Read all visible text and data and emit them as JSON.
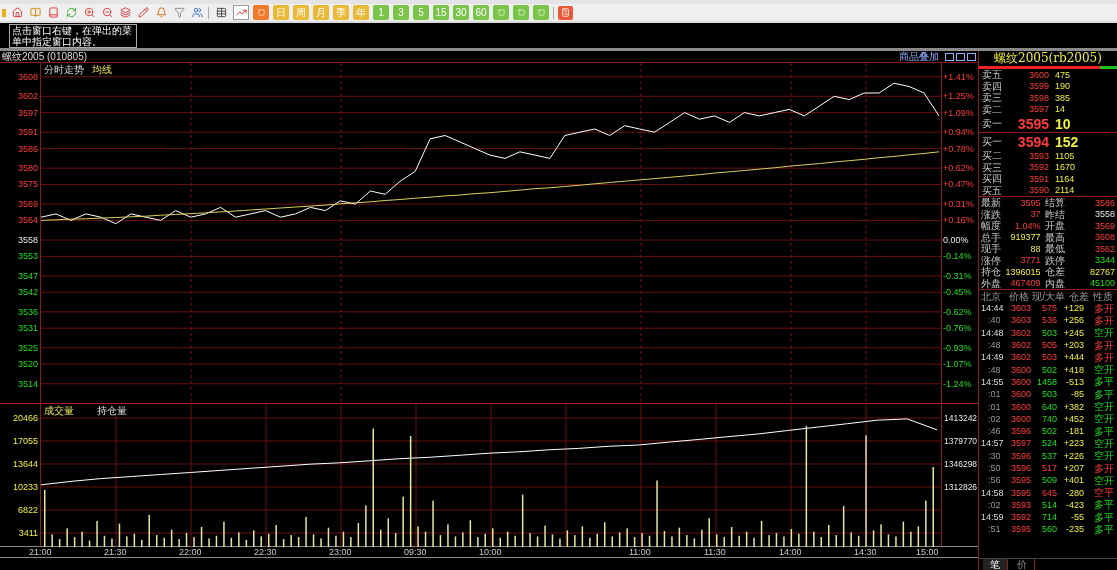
{
  "toolbar": {
    "tools": [
      {
        "kind": "table",
        "selected": false
      },
      {
        "kind": "trend",
        "selected": true
      }
    ],
    "periods": [
      {
        "kind": "tick",
        "color": "#f07a2a"
      },
      {
        "kind": "label",
        "label": "日",
        "color": "#e9b93a"
      },
      {
        "kind": "label",
        "label": "周",
        "color": "#e9b93a"
      },
      {
        "kind": "label",
        "label": "月",
        "color": "#e9b93a"
      },
      {
        "kind": "label",
        "label": "季",
        "color": "#e9b93a"
      },
      {
        "kind": "label",
        "label": "年",
        "color": "#e9b93a"
      },
      {
        "kind": "label",
        "label": "1",
        "color": "#7bc44a"
      },
      {
        "kind": "label",
        "label": "3",
        "color": "#7bc44a"
      },
      {
        "kind": "label",
        "label": "5",
        "color": "#7bc44a"
      },
      {
        "kind": "label",
        "label": "15",
        "color": "#7bc44a"
      },
      {
        "kind": "label",
        "label": "30",
        "color": "#7bc44a"
      },
      {
        "kind": "label",
        "label": "60",
        "color": "#7bc44a"
      },
      {
        "kind": "tick",
        "color": "#7bc44a"
      },
      {
        "kind": "tick",
        "color": "#7bc44a"
      },
      {
        "kind": "tick",
        "color": "#7bc44a"
      }
    ]
  },
  "tooltip": "点击窗口右键，在弹出的菜单中指定窗口内容。",
  "chart_header": {
    "title": "螺纹2005 (010805)",
    "overlay_button": "商品叠加"
  },
  "price_pane": {
    "chart_data": {
      "type": "line",
      "grid": true,
      "ylim": [
        3508.1,
        3612.2
      ],
      "yticks": [
        3608,
        3602,
        3597,
        3591,
        3586,
        3580,
        3575,
        3569,
        3564,
        3558,
        3553,
        3547,
        3542,
        3536,
        3531,
        3525,
        3520,
        3514
      ],
      "series": [
        {
          "name": "分时走势",
          "color": "#ffffff",
          "values": [
            3565,
            3566,
            3564,
            3566,
            3565,
            3563,
            3566,
            3565,
            3564,
            3567,
            3565,
            3566,
            3568,
            3565,
            3566,
            3567,
            3565,
            3566,
            3568,
            3567,
            3570,
            3569,
            3573,
            3572,
            3576,
            3579,
            3589,
            3590,
            3588,
            3586,
            3584,
            3583,
            3585,
            3584,
            3583,
            3590,
            3591,
            3592,
            3590,
            3593,
            3592,
            3591,
            3594,
            3597,
            3595,
            3596,
            3594,
            3597,
            3596,
            3597,
            3598,
            3596,
            3599,
            3602,
            3601,
            3603,
            3603,
            3606,
            3605,
            3603,
            3596
          ]
        },
        {
          "name": "均线",
          "color": "#d8d060",
          "values": [
            3564.0,
            3564.2,
            3564.4,
            3564.5,
            3564.7,
            3564.9,
            3565.1,
            3565.3,
            3565.6,
            3565.8,
            3566.1,
            3566.3,
            3566.6,
            3566.9,
            3567.2,
            3567.5,
            3567.8,
            3568.1,
            3568.4,
            3568.7,
            3569.1,
            3569.4,
            3569.7,
            3570.1,
            3570.4,
            3570.8,
            3571.1,
            3571.5,
            3571.8,
            3572.2,
            3572.5,
            3572.9,
            3573.3,
            3573.7,
            3574.0,
            3574.4,
            3574.8,
            3575.2,
            3575.6,
            3576.0,
            3576.4,
            3576.8,
            3577.2,
            3577.6,
            3578.0,
            3578.5,
            3578.9,
            3579.3,
            3579.7,
            3580.1,
            3580.6,
            3581.0,
            3581.4,
            3581.9,
            3582.3,
            3582.7,
            3583.2,
            3583.6,
            3584.1,
            3584.5,
            3585.0
          ]
        }
      ]
    },
    "right_ticks": [
      "+1.41%",
      "+1.25%",
      "+1.09%",
      "+0.94%",
      "+0.78%",
      "+0.62%",
      "+0.47%",
      "+0.31%",
      "+0.16%",
      "0.00%",
      "-0.14%",
      "-0.31%",
      "-0.45%",
      "-0.62%",
      "-0.76%",
      "-0.93%",
      "-1.07%",
      "-1.24%"
    ]
  },
  "volume_pane": {
    "volume_chart": {
      "chart_data": {
        "type": "bar",
        "grid": true,
        "ylim": [
          1335,
          22542
        ],
        "yticks": [
          20466,
          17055,
          13644,
          10233,
          6822,
          3411
        ],
        "series": [
          {
            "name": "成交量",
            "color": "#e6e6a0",
            "values": [
              9800,
              3200,
              2500,
              4100,
              2800,
              3600,
              2300,
              5200,
              3000,
              2600,
              4800,
              2900,
              3300,
              2400,
              6100,
              3100,
              2700,
              3900,
              2500,
              3400,
              2800,
              4300,
              2600,
              3000,
              5100,
              2700,
              3500,
              2400,
              3800,
              2900,
              3300,
              4600,
              2500,
              3100,
              2800,
              5800,
              3200,
              2600,
              4200,
              3000,
              3600,
              2800,
              4900,
              7500,
              18900,
              3900,
              5600,
              3400,
              8800,
              17800,
              4400,
              3600,
              8200,
              3100,
              4700,
              2900,
              3500,
              5300,
              2800,
              3300,
              4100,
              2700,
              3600,
              3000,
              9100,
              3400,
              2900,
              4500,
              3200,
              2600,
              3800,
              3100,
              4400,
              2700,
              3300,
              5000,
              2900,
              3500,
              4100,
              2800,
              3400,
              3000,
              11200,
              3700,
              2900,
              4200,
              3100,
              2600,
              3900,
              5600,
              3200,
              2800,
              4300,
              3000,
              3600,
              2700,
              5200,
              3100,
              3400,
              2900,
              4000,
              3300,
              19300,
              3600,
              2800,
              4600,
              3100,
              7400,
              3500,
              3000,
              17900,
              3800,
              4700,
              3200,
              2900,
              5100,
              3600,
              4400,
              8200,
              13200
            ]
          }
        ]
      }
    },
    "open_interest_chart": {
      "chart_data": {
        "type": "line",
        "ylim": [
          1225513,
          1433616
        ],
        "yticks": [
          1413242,
          1379770,
          1346298,
          1312826
        ],
        "series": [
          {
            "name": "持仓量",
            "color": "#ffffff",
            "values": [
              1316000,
              1321000,
              1325000,
              1328000,
              1331000,
              1334000,
              1337000,
              1340000,
              1343000,
              1346000,
              1348000,
              1351000,
              1354000,
              1356000,
              1359000,
              1362000,
              1364000,
              1367000,
              1369000,
              1372000,
              1374000,
              1378000,
              1382000,
              1386000,
              1390000,
              1395000,
              1400000,
              1405000,
              1410000,
              1412000,
              1396000
            ]
          }
        ]
      }
    }
  },
  "time_axis": [
    "21:00",
    "21:30",
    "22:00",
    "22:30",
    "23:00",
    "09:30",
    "10:00",
    "11:00",
    "11:30",
    "14:00",
    "14:30",
    "15:00"
  ],
  "quote": {
    "title": "螺纹2005(rb2005)",
    "ratio_bar": {
      "level": 0.88
    },
    "asks": [
      {
        "label": "卖五",
        "price": "3600",
        "volume": "475",
        "kind": "level"
      },
      {
        "label": "卖四",
        "price": "3599",
        "volume": "190",
        "kind": "level"
      },
      {
        "label": "卖三",
        "price": "3598",
        "volume": "385",
        "kind": "level"
      },
      {
        "label": "卖二",
        "price": "3597",
        "volume": "14",
        "kind": "level"
      },
      {
        "label": "卖一",
        "price": "3595",
        "volume": "10",
        "kind": "best"
      }
    ],
    "bids": [
      {
        "label": "买一",
        "price": "3594",
        "volume": "152",
        "kind": "best"
      },
      {
        "label": "买二",
        "price": "3593",
        "volume": "1105",
        "kind": "level"
      },
      {
        "label": "买三",
        "price": "3592",
        "volume": "1670",
        "kind": "level"
      },
      {
        "label": "买四",
        "price": "3591",
        "volume": "1164",
        "kind": "level"
      },
      {
        "label": "买五",
        "price": "3590",
        "volume": "2114",
        "kind": "level"
      }
    ],
    "stats_left": [
      {
        "label": "最新",
        "value": "3595",
        "kind": "up"
      },
      {
        "label": "涨跌",
        "value": "37",
        "kind": "up"
      },
      {
        "label": "幅度",
        "value": "1.04%",
        "kind": "up"
      },
      {
        "label": "总手",
        "value": "919377",
        "kind": "volume"
      },
      {
        "label": "现手",
        "value": "88",
        "kind": "volume"
      },
      {
        "label": "涨停",
        "value": "3771",
        "kind": "up"
      },
      {
        "label": "持仓",
        "value": "1396015",
        "kind": "volume"
      },
      {
        "label": "外盘",
        "value": "467409",
        "kind": "up"
      }
    ],
    "stats_right": [
      {
        "label": "结算",
        "value": "3586",
        "kind": "up"
      },
      {
        "label": "昨结",
        "value": "3558",
        "kind": "flat"
      },
      {
        "label": "开盘",
        "value": "3569",
        "kind": "up"
      },
      {
        "label": "最高",
        "value": "3608",
        "kind": "up"
      },
      {
        "label": "最低",
        "value": "3562",
        "kind": "up"
      },
      {
        "label": "跌停",
        "value": "3344",
        "kind": "down"
      },
      {
        "label": "仓差",
        "value": "82767",
        "kind": "volume"
      },
      {
        "label": "内盘",
        "value": "45100",
        "kind": "down"
      }
    ],
    "ticks_header": [
      "北京",
      "价格",
      "现/大单",
      "仓差",
      "性质"
    ],
    "ticks": [
      {
        "time": "14:44",
        "price": "3603",
        "volume": "575",
        "buyer_initiated": true,
        "oi": "+129",
        "nature": "多开",
        "kind": "open_long"
      },
      {
        "time": ":40",
        "price": "3603",
        "volume": "536",
        "buyer_initiated": true,
        "oi": "+256",
        "nature": "多开",
        "kind": "open_long"
      },
      {
        "time": "14:48",
        "price": "3602",
        "volume": "503",
        "buyer_initiated": false,
        "oi": "+245",
        "nature": "空开",
        "kind": "open_short"
      },
      {
        "time": ":48",
        "price": "3602",
        "volume": "505",
        "buyer_initiated": true,
        "oi": "+203",
        "nature": "多开",
        "kind": "open_long"
      },
      {
        "time": "14:49",
        "price": "3602",
        "volume": "503",
        "buyer_initiated": true,
        "oi": "+444",
        "nature": "多开",
        "kind": "open_long"
      },
      {
        "time": ":48",
        "price": "3600",
        "volume": "502",
        "buyer_initiated": false,
        "oi": "+418",
        "nature": "空开",
        "kind": "open_short"
      },
      {
        "time": "14:55",
        "price": "3600",
        "volume": "1458",
        "buyer_initiated": false,
        "oi": "-513",
        "nature": "多平",
        "kind": "close_long"
      },
      {
        "time": ":01",
        "price": "3600",
        "volume": "503",
        "buyer_initiated": false,
        "oi": "-85",
        "nature": "多平",
        "kind": "close_long"
      },
      {
        "time": ":01",
        "price": "3600",
        "volume": "640",
        "buyer_initiated": false,
        "oi": "+382",
        "nature": "空开",
        "kind": "open_short"
      },
      {
        "time": ":02",
        "price": "3600",
        "volume": "740",
        "buyer_initiated": false,
        "oi": "+452",
        "nature": "空开",
        "kind": "open_short"
      },
      {
        "time": ":46",
        "price": "3596",
        "volume": "502",
        "buyer_initiated": false,
        "oi": "-181",
        "nature": "多平",
        "kind": "close_long"
      },
      {
        "time": "14:57",
        "price": "3597",
        "volume": "524",
        "buyer_initiated": false,
        "oi": "+223",
        "nature": "空开",
        "kind": "open_short"
      },
      {
        "time": ":30",
        "price": "3596",
        "volume": "537",
        "buyer_initiated": false,
        "oi": "+226",
        "nature": "空开",
        "kind": "open_short"
      },
      {
        "time": ":50",
        "price": "3596",
        "volume": "517",
        "buyer_initiated": true,
        "oi": "+207",
        "nature": "多开",
        "kind": "open_long"
      },
      {
        "time": ":56",
        "price": "3595",
        "volume": "509",
        "buyer_initiated": false,
        "oi": "+401",
        "nature": "空开",
        "kind": "open_short"
      },
      {
        "time": "14:58",
        "price": "3595",
        "volume": "645",
        "buyer_initiated": true,
        "oi": "-280",
        "nature": "空平",
        "kind": "close_short"
      },
      {
        "time": ":02",
        "price": "3593",
        "volume": "514",
        "buyer_initiated": false,
        "oi": "-423",
        "nature": "多平",
        "kind": "close_long"
      },
      {
        "time": "14:59",
        "price": "3592",
        "volume": "714",
        "buyer_initiated": false,
        "oi": "-55",
        "nature": "多平",
        "kind": "close_long"
      },
      {
        "time": ":51",
        "price": "3595",
        "volume": "560",
        "buyer_initiated": false,
        "oi": "-235",
        "nature": "多平",
        "kind": "close_long"
      }
    ],
    "tabs": [
      {
        "label": "笔",
        "selected": true
      },
      {
        "label": "价",
        "selected": false
      }
    ]
  }
}
